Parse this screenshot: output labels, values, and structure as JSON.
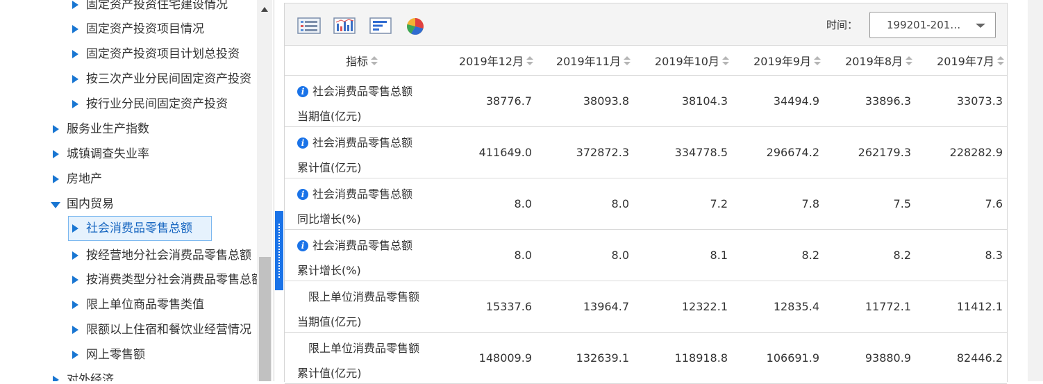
{
  "tree": {
    "items": [
      {
        "label": "固定资产投资住宅建设情况",
        "level": 2,
        "state": "collapsed"
      },
      {
        "label": "固定资产投资项目情况",
        "level": 2,
        "state": "collapsed"
      },
      {
        "label": "固定资产投资项目计划总投资",
        "level": 2,
        "state": "collapsed"
      },
      {
        "label": "按三次产业分民间固定资产投资",
        "level": 2,
        "state": "collapsed"
      },
      {
        "label": "按行业分民间固定资产投资",
        "level": 2,
        "state": "collapsed"
      },
      {
        "label": "服务业生产指数",
        "level": 1,
        "state": "collapsed"
      },
      {
        "label": "城镇调查失业率",
        "level": 1,
        "state": "collapsed"
      },
      {
        "label": "房地产",
        "level": 1,
        "state": "collapsed"
      },
      {
        "label": "国内贸易",
        "level": 1,
        "state": "expanded"
      },
      {
        "label": "社会消费品零售总额",
        "level": 2,
        "state": "selected"
      },
      {
        "label": "按经营地分社会消费品零售总额",
        "level": 2,
        "state": "collapsed"
      },
      {
        "label": "按消费类型分社会消费品零售总额",
        "level": 2,
        "state": "collapsed"
      },
      {
        "label": "限上单位商品零售类值",
        "level": 2,
        "state": "collapsed"
      },
      {
        "label": "限额以上住宿和餐饮业经营情况",
        "level": 2,
        "state": "collapsed"
      },
      {
        "label": "网上零售额",
        "level": 2,
        "state": "collapsed"
      },
      {
        "label": "对外经济",
        "level": 1,
        "state": "collapsed"
      }
    ]
  },
  "toolbar": {
    "icons": [
      "table-view-icon",
      "bar-chart-icon",
      "horizontal-bar-icon",
      "pie-chart-icon"
    ],
    "time_label": "时间：",
    "time_value": "199201-201…"
  },
  "table": {
    "indicator_header": "指标",
    "columns": [
      "2019年12月",
      "2019年11月",
      "2019年10月",
      "2019年9月",
      "2019年8月",
      "2019年7月"
    ],
    "rows": [
      {
        "line1": "社会消费品零售总额",
        "line2": "当期值(亿元)",
        "info": true,
        "values": [
          "38776.7",
          "38093.8",
          "38104.3",
          "34494.9",
          "33896.3",
          "33073.3"
        ]
      },
      {
        "line1": "社会消费品零售总额",
        "line2": "累计值(亿元)",
        "info": true,
        "values": [
          "411649.0",
          "372872.3",
          "334778.5",
          "296674.2",
          "262179.3",
          "228282.9"
        ]
      },
      {
        "line1": "社会消费品零售总额",
        "line2": "同比增长(%)",
        "info": true,
        "values": [
          "8.0",
          "8.0",
          "7.2",
          "7.8",
          "7.5",
          "7.6"
        ]
      },
      {
        "line1": "社会消费品零售总额",
        "line2": "累计增长(%)",
        "info": true,
        "values": [
          "8.0",
          "8.0",
          "8.1",
          "8.2",
          "8.2",
          "8.3"
        ]
      },
      {
        "line1": "限上单位消费品零售额",
        "line2": "当期值(亿元)",
        "info": false,
        "values": [
          "15337.6",
          "13964.7",
          "12322.1",
          "12835.4",
          "11772.1",
          "11412.1"
        ]
      },
      {
        "line1": "限上单位消费品零售额",
        "line2": "累计值(亿元)",
        "info": false,
        "values": [
          "148009.9",
          "132639.1",
          "118918.8",
          "106691.9",
          "93880.9",
          "82446.2"
        ]
      }
    ]
  },
  "colors": {
    "accent": "#1a73e8",
    "selected_bg": "#e6f2fd",
    "selected_border": "#7ab7ef"
  }
}
